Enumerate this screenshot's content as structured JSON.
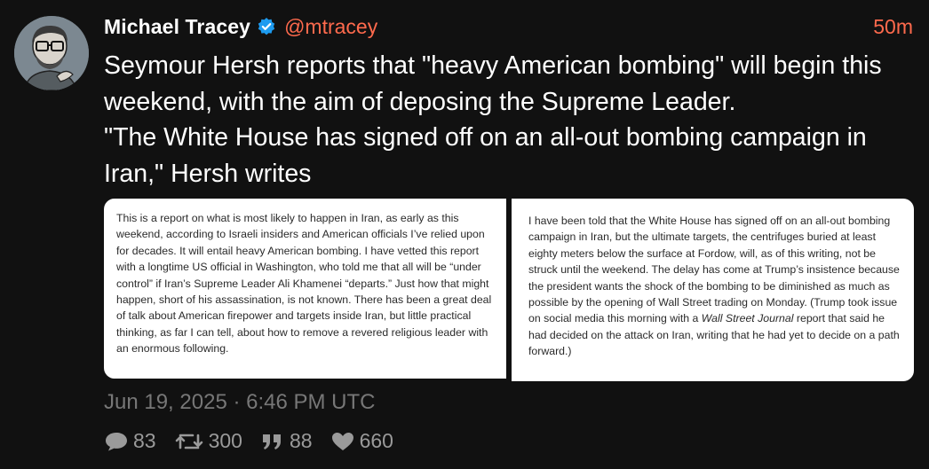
{
  "tweet": {
    "author_name": "Michael Tracey",
    "handle": "@mtracey",
    "time_ago": "50m",
    "text": "Seymour Hersh reports that \"heavy American bombing\" will begin this weekend, with the aim of deposing the Supreme Leader.\n\"The White House has signed off on an all-out bombing campaign in Iran,\" Hersh writes",
    "date": "Jun 19, 2025 · 6:46 PM UTC",
    "verified_icon": "verified-badge-icon",
    "accent_color": "#ff6a4d",
    "verified_color": "#1d9bf0"
  },
  "media": {
    "left_text": "This is a report on what is most likely to happen in Iran, as early as this weekend, according to Israeli insiders and American officials I’ve relied upon for decades. It will entail heavy American bombing. I have vetted this report with a longtime US official in Washington, who told me that all will be “under control” if Iran’s Supreme Leader Ali Khamenei “departs.” Just how that might happen, short of his assassination, is not known. There has been a great deal of talk about American firepower and targets inside Iran, but little practical thinking, as far I can tell, about how to remove a revered religious leader with an enormous following.",
    "right_text_before": "I have been told that the White House has signed off on an all-out bombing campaign in Iran, but the ultimate targets, the centrifuges buried at least eighty meters below the surface at Fordow, will, as of this writing, not be struck until the weekend. The delay has come at Trump’s insistence because the president wants the shock of the bombing to be diminished as much as possible by the opening of Wall Street trading on Monday. (Trump took issue on social media this morning with a ",
    "right_text_italic": "Wall Street Journal",
    "right_text_after": " report that said he had decided on the attack on Iran, writing that he had yet to decide on a path forward.)"
  },
  "stats": {
    "replies": "83",
    "retweets": "300",
    "quotes": "88",
    "likes": "660",
    "icons": [
      "comment-icon",
      "retweet-icon",
      "quote-icon",
      "heart-icon"
    ]
  }
}
